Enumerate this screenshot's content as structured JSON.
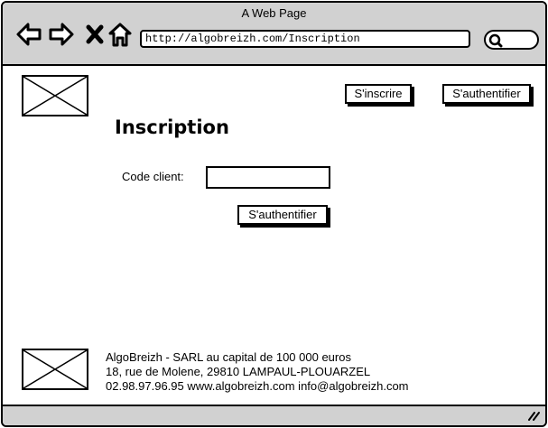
{
  "browser": {
    "title": "A Web Page",
    "url": "http://algobreizh.com/Inscription",
    "icons": [
      "back-icon",
      "forward-icon",
      "close-icon",
      "home-icon",
      "search-icon",
      "resize-grip-icon"
    ]
  },
  "header": {
    "signup_label": "S'inscrire",
    "login_label": "S'authentifier"
  },
  "main": {
    "title": "Inscription",
    "client_code_label": "Code client:",
    "client_code_value": "",
    "submit_label": "S'authentifier"
  },
  "footer": {
    "line1": "AlgoBreizh - SARL au capital de 100 000 euros",
    "line2": "18, rue de Molene, 29810 LAMPAUL-PLOUARZEL",
    "line3": "02.98.97.96.95 www.algobreizh.com info@algobreizh.com"
  }
}
